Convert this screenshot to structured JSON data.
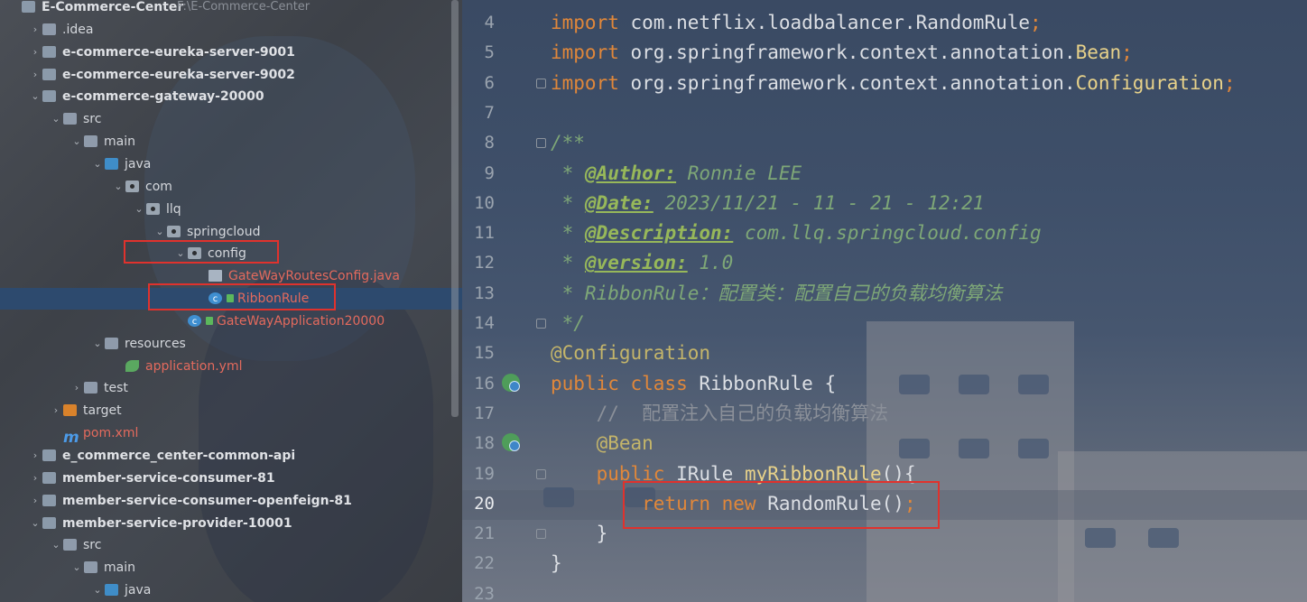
{
  "project": {
    "name": "E-Commerce-Center",
    "path": "F:\\E-Commerce-Center"
  },
  "tree": [
    {
      "label": "E-Commerce-Center",
      "path": "F:\\E-Commerce-Center",
      "icon": "module-icon",
      "arrow": "",
      "bold": true
    },
    {
      "label": ".idea",
      "icon": "folder-icon",
      "arrow": "›",
      "bold": false
    },
    {
      "label": "e-commerce-eureka-server-9001",
      "icon": "module-icon",
      "arrow": "›",
      "bold": true
    },
    {
      "label": "e-commerce-eureka-server-9002",
      "icon": "module-icon",
      "arrow": "›",
      "bold": true
    },
    {
      "label": "e-commerce-gateway-20000",
      "icon": "module-icon",
      "arrow": "⌄",
      "bold": true
    },
    {
      "label": "src",
      "icon": "folder-icon",
      "arrow": "⌄",
      "bold": false
    },
    {
      "label": "main",
      "icon": "folder-icon",
      "arrow": "⌄",
      "bold": false
    },
    {
      "label": "java",
      "icon": "source-folder-icon",
      "arrow": "⌄",
      "bold": false
    },
    {
      "label": "com",
      "icon": "package-icon",
      "arrow": "⌄",
      "bold": false
    },
    {
      "label": "llq",
      "icon": "package-icon",
      "arrow": "⌄",
      "bold": false
    },
    {
      "label": "springcloud",
      "icon": "package-icon",
      "arrow": "⌄",
      "bold": false
    },
    {
      "label": "config",
      "icon": "package-icon",
      "arrow": "⌄",
      "bold": false
    },
    {
      "label": "GateWayRoutesConfig.java",
      "icon": "java-file-icon",
      "arrow": "",
      "bold": false,
      "red": true
    },
    {
      "label": "RibbonRule",
      "icon": "class-icon",
      "arrow": "",
      "bold": false,
      "red": true,
      "selected": true
    },
    {
      "label": "GateWayApplication20000",
      "icon": "spring-boot-class-icon",
      "arrow": "",
      "bold": false,
      "red": true
    },
    {
      "label": "resources",
      "icon": "resources-folder-icon",
      "arrow": "⌄",
      "bold": false
    },
    {
      "label": "application.yml",
      "icon": "yaml-file-icon",
      "arrow": "",
      "bold": false,
      "red": true
    },
    {
      "label": "test",
      "icon": "folder-icon",
      "arrow": "›",
      "bold": false
    },
    {
      "label": "target",
      "icon": "excluded-folder-icon",
      "arrow": "›",
      "bold": false
    },
    {
      "label": "pom.xml",
      "icon": "maven-icon",
      "arrow": "",
      "bold": false,
      "red": true
    },
    {
      "label": "e_commerce_center-common-api",
      "icon": "module-icon",
      "arrow": "›",
      "bold": true
    },
    {
      "label": "member-service-consumer-81",
      "icon": "module-icon",
      "arrow": "›",
      "bold": true
    },
    {
      "label": "member-service-consumer-openfeign-81",
      "icon": "module-icon",
      "arrow": "›",
      "bold": true
    },
    {
      "label": "member-service-provider-10001",
      "icon": "module-icon",
      "arrow": "⌄",
      "bold": true
    },
    {
      "label": "src",
      "icon": "folder-icon",
      "arrow": "⌄",
      "bold": false
    },
    {
      "label": "main",
      "icon": "folder-icon",
      "arrow": "⌄",
      "bold": false
    },
    {
      "label": "java",
      "icon": "source-folder-icon",
      "arrow": "⌄",
      "bold": false
    }
  ],
  "editor": {
    "current_line": 20,
    "lines": [
      {
        "n": 4,
        "tokens": [
          [
            "kw",
            "import"
          ],
          [
            "cls",
            " com.netflix.loadbalancer.RandomRule"
          ],
          [
            "kw",
            ";"
          ]
        ]
      },
      {
        "n": 5,
        "tokens": [
          [
            "kw",
            "import"
          ],
          [
            "cls",
            " org.springframework.context.annotation."
          ],
          [
            "fn",
            "Bean"
          ],
          [
            "kw",
            ";"
          ]
        ]
      },
      {
        "n": 6,
        "tokens": [
          [
            "kw",
            "import"
          ],
          [
            "cls",
            " org.springframework.context.annotation."
          ],
          [
            "fn",
            "Configuration"
          ],
          [
            "kw",
            ";"
          ]
        ]
      },
      {
        "n": 7,
        "tokens": []
      },
      {
        "n": 8,
        "tokens": [
          [
            "doc",
            "/**"
          ]
        ]
      },
      {
        "n": 9,
        "tokens": [
          [
            "doc",
            " * "
          ],
          [
            "doctag",
            "@Author:"
          ],
          [
            "doc",
            " Ronnie LEE"
          ]
        ]
      },
      {
        "n": 10,
        "tokens": [
          [
            "doc",
            " * "
          ],
          [
            "doctag",
            "@Date:"
          ],
          [
            "doc",
            " 2023/11/21 - 11 - 21 - 12:21"
          ]
        ]
      },
      {
        "n": 11,
        "tokens": [
          [
            "doc",
            " * "
          ],
          [
            "doctag",
            "@Description:"
          ],
          [
            "doc",
            " com.llq.springcloud.config"
          ]
        ]
      },
      {
        "n": 12,
        "tokens": [
          [
            "doc",
            " * "
          ],
          [
            "doctag",
            "@version:"
          ],
          [
            "doc",
            " 1.0"
          ]
        ]
      },
      {
        "n": 13,
        "tokens": [
          [
            "doc",
            " * RibbonRule：配置类：配置自己的负载均衡算法"
          ]
        ]
      },
      {
        "n": 14,
        "tokens": [
          [
            "doc",
            " */"
          ]
        ]
      },
      {
        "n": 15,
        "tokens": [
          [
            "ann",
            "@Configuration"
          ]
        ]
      },
      {
        "n": 16,
        "tokens": [
          [
            "kw",
            "public class "
          ],
          [
            "cls",
            "RibbonRule {"
          ]
        ]
      },
      {
        "n": 17,
        "tokens": [
          [
            "cmt",
            "    //  配置注入自己的负载均衡算法"
          ]
        ]
      },
      {
        "n": 18,
        "tokens": [
          [
            "ann",
            "    @Bean"
          ]
        ]
      },
      {
        "n": 19,
        "tokens": [
          [
            "kw",
            "    public "
          ],
          [
            "cls",
            "IRule "
          ],
          [
            "fn",
            "myRibbonRule"
          ],
          [
            "cls",
            "(){"
          ]
        ]
      },
      {
        "n": 20,
        "tokens": [
          [
            "kw",
            "        return new "
          ],
          [
            "cls",
            "RandomRule()"
          ],
          [
            "kw",
            ";"
          ]
        ]
      },
      {
        "n": 21,
        "tokens": [
          [
            "cls",
            "    }"
          ]
        ]
      },
      {
        "n": 22,
        "tokens": [
          [
            "cls",
            "}"
          ]
        ]
      },
      {
        "n": 23,
        "tokens": []
      }
    ]
  },
  "colors": {
    "highlight_box": "#e0322d",
    "keyword": "#e0873a",
    "annotation": "#c4b56a",
    "doc_comment": "#7ea777",
    "selected_row": "#2d4a6e",
    "vcs_new_file": "#e36a5d"
  }
}
